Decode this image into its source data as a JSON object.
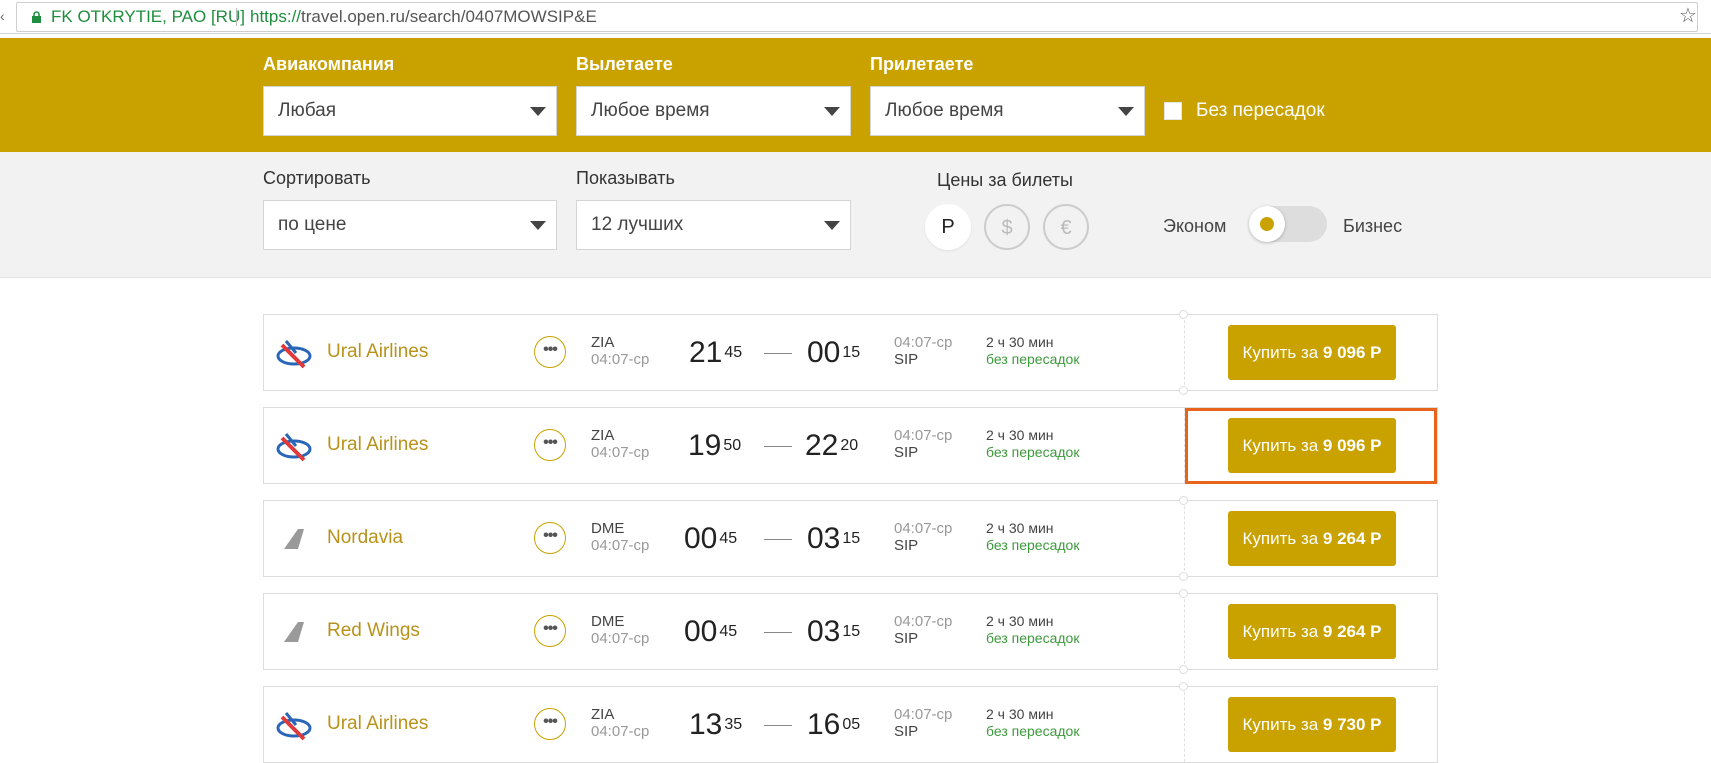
{
  "browser": {
    "secure_label": "FK OTKRYTIE, PAO [RU]",
    "url_proto": "https://",
    "url_rest": "travel.open.ru/search/0407MOWSIP&E",
    "star_glyph": "☆",
    "left_edge_glyph": "‹"
  },
  "filters": {
    "airline_label": "Авиакомпания",
    "airline_value": "Любая",
    "depart_label": "Вылетаете",
    "depart_value": "Любое время",
    "arrive_label": "Прилетаете",
    "arrive_value": "Любое время",
    "nonstop_label": "Без пересадок",
    "nonstop_checked": false
  },
  "settings": {
    "sort_label": "Сортировать",
    "sort_value": "по цене",
    "show_label": "Показывать",
    "show_value": "12 лучших",
    "currency_label": "Цены за билеты",
    "currencies": [
      "Р",
      "$",
      "€"
    ],
    "active_currency": "Р",
    "class_economy": "Эконом",
    "class_business": "Бизнес"
  },
  "more_glyph": "•••",
  "flights": [
    {
      "airline": "Ural Airlines",
      "logo": "ural-airlines-logo",
      "dep_code": "ZIA",
      "dep_date": "04:07-ср",
      "dep_h": "21",
      "dep_m": "45",
      "arr_h": "00",
      "arr_m": "15",
      "arr_date": "04:07-ср",
      "arr_code": "SIP",
      "duration": "2 ч 30 мин",
      "stops": "без пересадок",
      "buy_prefix": "Купить за ",
      "price": "9 096 Р"
    },
    {
      "airline": "Ural Airlines",
      "logo": "ural-airlines-logo",
      "dep_code": "ZIA",
      "dep_date": "04:07-ср",
      "dep_h": "19",
      "dep_m": "50",
      "arr_h": "22",
      "arr_m": "20",
      "arr_date": "04:07-ср",
      "arr_code": "SIP",
      "duration": "2 ч 30 мин",
      "stops": "без пересадок",
      "buy_prefix": "Купить за ",
      "price": "9 096 Р"
    },
    {
      "airline": "Nordavia",
      "logo": "tail-logo",
      "dep_code": "DME",
      "dep_date": "04:07-ср",
      "dep_h": "00",
      "dep_m": "45",
      "arr_h": "03",
      "arr_m": "15",
      "arr_date": "04:07-ср",
      "arr_code": "SIP",
      "duration": "2 ч 30 мин",
      "stops": "без пересадок",
      "buy_prefix": "Купить за ",
      "price": "9 264 Р"
    },
    {
      "airline": "Red Wings",
      "logo": "tail-logo",
      "dep_code": "DME",
      "dep_date": "04:07-ср",
      "dep_h": "00",
      "dep_m": "45",
      "arr_h": "03",
      "arr_m": "15",
      "arr_date": "04:07-ср",
      "arr_code": "SIP",
      "duration": "2 ч 30 мин",
      "stops": "без пересадок",
      "buy_prefix": "Купить за ",
      "price": "9 264 Р"
    },
    {
      "airline": "Ural Airlines",
      "logo": "ural-airlines-logo",
      "dep_code": "ZIA",
      "dep_date": "04:07-ср",
      "dep_h": "13",
      "dep_m": "35",
      "arr_h": "16",
      "arr_m": "05",
      "arr_date": "04:07-ср",
      "arr_code": "SIP",
      "duration": "2 ч 30 мин",
      "stops": "без пересадок",
      "buy_prefix": "Купить за ",
      "price": "9 730 Р"
    }
  ],
  "colors": {
    "brand_gold": "#c9a200",
    "highlight": "#e8631c",
    "secure_green": "#1e8e3e"
  }
}
